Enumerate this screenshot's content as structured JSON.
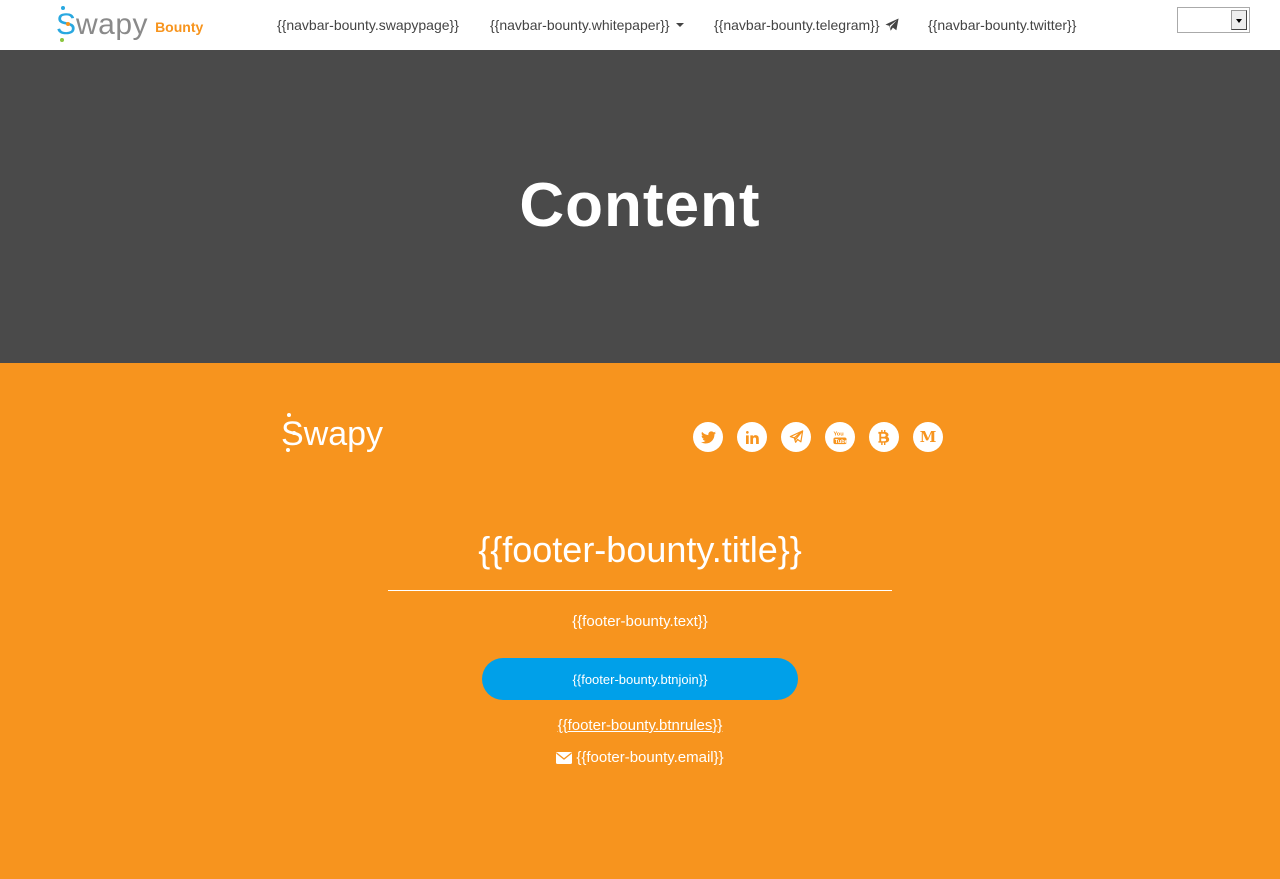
{
  "navbar": {
    "brand_logo_text": "Swapy",
    "brand_suffix": "Bounty",
    "items": [
      {
        "label": "{{navbar-bounty.swapypage}}"
      },
      {
        "label": "{{navbar-bounty.whitepaper}}"
      },
      {
        "label": "{{navbar-bounty.telegram}}"
      },
      {
        "label": "{{navbar-bounty.twitter}}"
      }
    ],
    "language_select": {
      "value": ""
    }
  },
  "hero": {
    "title": "Content"
  },
  "footer": {
    "logo_text": "Swapy",
    "socials": [
      {
        "icon": "twitter-icon"
      },
      {
        "icon": "linkedin-icon"
      },
      {
        "icon": "telegram-icon"
      },
      {
        "icon": "youtube-icon"
      },
      {
        "icon": "bitcoin-icon"
      },
      {
        "icon": "medium-icon",
        "glyph": "M"
      }
    ],
    "title": "{{footer-bounty.title}}",
    "text": "{{footer-bounty.text}}",
    "btn_join": "{{footer-bounty.btnjoin}}",
    "btn_rules": "{{footer-bounty.btnrules}}",
    "email": "{{footer-bounty.email}}"
  },
  "colors": {
    "accent_orange": "#f7941e",
    "hero_bg": "#4a4a4a",
    "button_blue": "#00a0e9",
    "brand_blue": "#29a8e0"
  }
}
